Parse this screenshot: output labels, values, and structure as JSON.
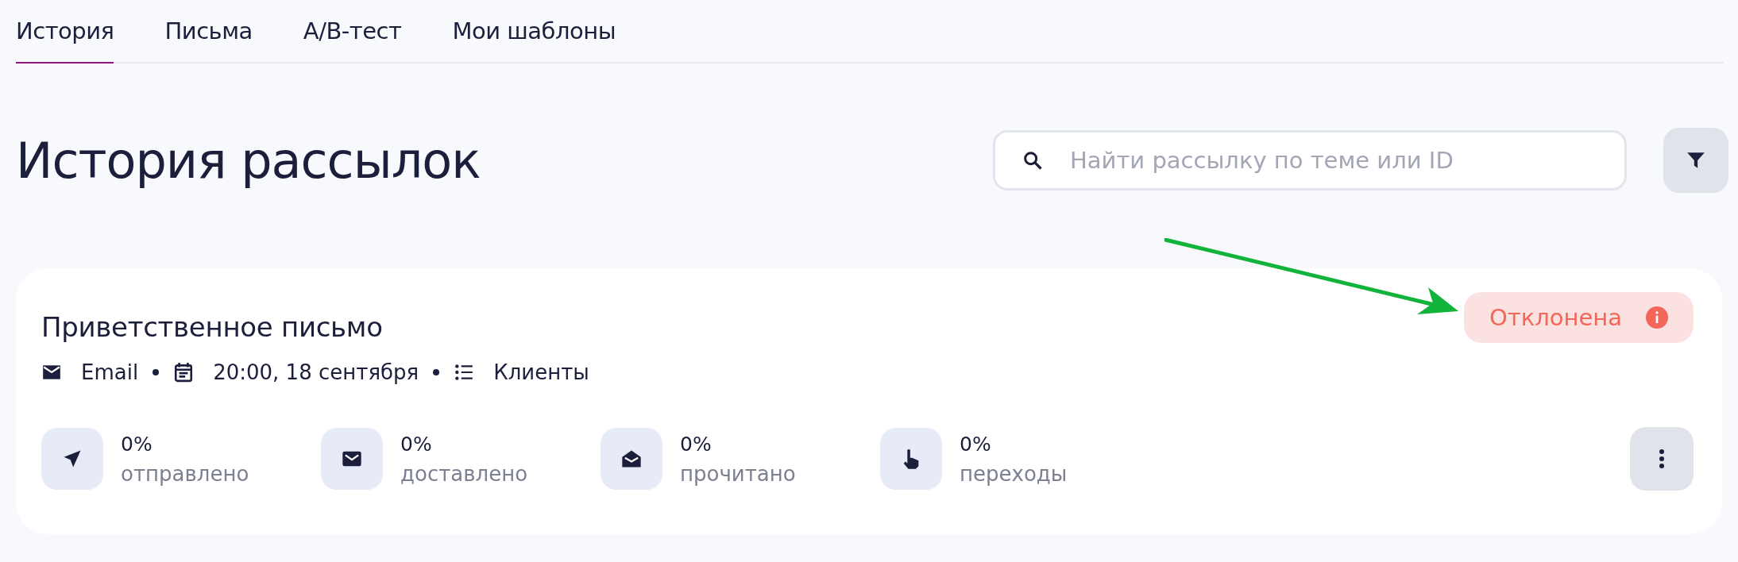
{
  "tabs": [
    {
      "label": "История",
      "selected": true
    },
    {
      "label": "Письма",
      "selected": false
    },
    {
      "label": "A/B-тест",
      "selected": false
    },
    {
      "label": "Мои шаблоны",
      "selected": false
    }
  ],
  "page_title": "История рассылок",
  "search": {
    "placeholder": "Найти рассылку по теме или ID"
  },
  "campaign": {
    "title": "Приветственное письмо",
    "meta": [
      {
        "kind": "channel",
        "text": "Email"
      },
      {
        "kind": "date",
        "text": "20:00, 18 сентября"
      },
      {
        "kind": "list",
        "text": "Клиенты"
      }
    ],
    "status": {
      "label": "Отклонена",
      "kind": "rejected"
    },
    "stats": [
      {
        "kind": "sent",
        "value": "0%",
        "label": "отправлено"
      },
      {
        "kind": "delivered",
        "value": "0%",
        "label": "доставлено"
      },
      {
        "kind": "read",
        "value": "0%",
        "label": "прочитано"
      },
      {
        "kind": "clicks",
        "value": "0%",
        "label": "переходы"
      }
    ]
  }
}
